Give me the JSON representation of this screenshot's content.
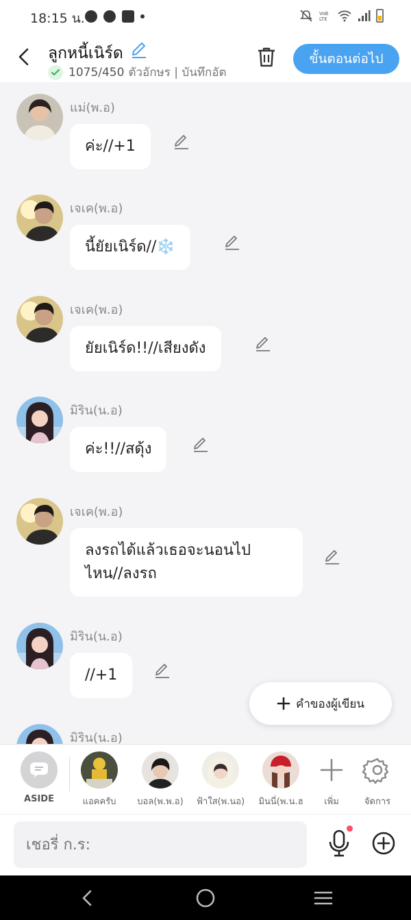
{
  "status": {
    "time": "18:15 น.",
    "icons": [
      "messenger-icon",
      "signal-app-icon",
      "facebook-icon",
      "dot-icon"
    ],
    "right_icons": [
      "mute-icon",
      "volte-icon",
      "wifi-icon",
      "signal-icon",
      "battery-icon"
    ]
  },
  "header": {
    "title": "ลูกหนี้เนิร์ด",
    "char_count": "1075/450",
    "subtitle": "ตัวอักษร | บันทึกอัต",
    "next_label": "ขั้นตอนต่อไป"
  },
  "messages": [
    {
      "name": "แม่(พ.อ)",
      "text": "ค่ะ//+1"
    },
    {
      "name": "เจเค(พ.อ)",
      "text": "นี้ยัยเนิร์ด//",
      "emoji": "❄️"
    },
    {
      "name": "เจเค(พ.อ)",
      "text": "ยัยเนิร์ด!!//เสียงดัง"
    },
    {
      "name": "มิริน(น.อ)",
      "text": "ค่ะ!!//สดุ้ง"
    },
    {
      "name": "เจเค(พ.อ)",
      "text_line1": "ลงรถได้แล้วเธอจะนอนไป",
      "text_line2": "ไหน//ลงรถ"
    },
    {
      "name": "มิริน(น.อ)",
      "text": "//+1"
    },
    {
      "name": "มิริน(น.อ)"
    }
  ],
  "fab": {
    "label": "คำของผู้เขียน"
  },
  "characters": {
    "aside": "ASIDE",
    "items": [
      "แอคครับ",
      "บอล(พ.พ.อ)",
      "ฟ้าใส(พ.นอ)",
      "มินนี่(พ.น.ฮ"
    ],
    "add": "เพิ่ม",
    "manage": "จัดการ"
  },
  "input": {
    "placeholder": "เชอรี่ ก.ร:"
  },
  "colors": {
    "accent": "#4aa3f0",
    "background": "#f4f4f6",
    "bubble": "#ffffff"
  }
}
